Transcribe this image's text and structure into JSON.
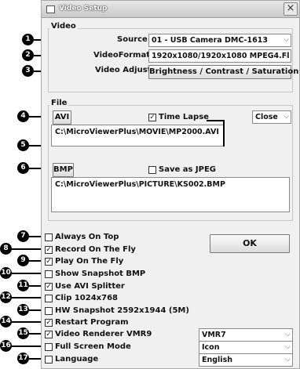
{
  "window": {
    "title": "Video Setup",
    "close_glyph": "×"
  },
  "video": {
    "group_label": "Video",
    "source_label": "Source",
    "source_value": "01 - USB Camera DMC-1613",
    "format_label": "VideoFormat",
    "format_value": "1920x1080/1920x1080 MPEG4.Fl",
    "adjust_label": "Video Adjust",
    "adjust_button": "Brightness / Contrast / Saturation"
  },
  "file": {
    "group_label": "File",
    "avi_button": "AVI",
    "time_lapse_label": "Time Lapse",
    "time_lapse_checked": true,
    "close_combo": "Close",
    "avi_path": "C:\\MicroViewerPlus\\MOVIE\\MP2000.AVI",
    "bmp_button": "BMP",
    "save_jpeg_label": "Save as JPEG",
    "save_jpeg_checked": false,
    "bmp_path": "C:\\MicroViewerPlus\\PICTURE\\KS002.BMP"
  },
  "options": [
    {
      "label": "Always On Top",
      "checked": false
    },
    {
      "label": "Record On The Fly",
      "checked": true
    },
    {
      "label": "Play On The Fly",
      "checked": true
    },
    {
      "label": "Show Snapshot BMP",
      "checked": false
    },
    {
      "label": "Use AVI Splitter",
      "checked": true
    },
    {
      "label": "Clip 1024x768",
      "checked": false
    },
    {
      "label": "HW Snapshot 2592x1944 (5M)",
      "checked": false
    },
    {
      "label": "Restart Program",
      "checked": true
    },
    {
      "label": "Video Renderer VMR9",
      "checked": true
    },
    {
      "label": "Full Screen Mode",
      "checked": false
    },
    {
      "label": "Language",
      "checked": false
    }
  ],
  "ok_button": "OK",
  "renderer_combo": "VMR7",
  "fullscreen_combo": "Icon",
  "language_combo": "English",
  "callouts": [
    "1",
    "2",
    "3",
    "4",
    "5",
    "6",
    "7",
    "8",
    "9",
    "10",
    "11",
    "12",
    "13",
    "14",
    "15",
    "16",
    "17"
  ],
  "icons": {
    "window": "window-icon",
    "combo_arrow": "chevron-down-icon",
    "check": "✓"
  }
}
